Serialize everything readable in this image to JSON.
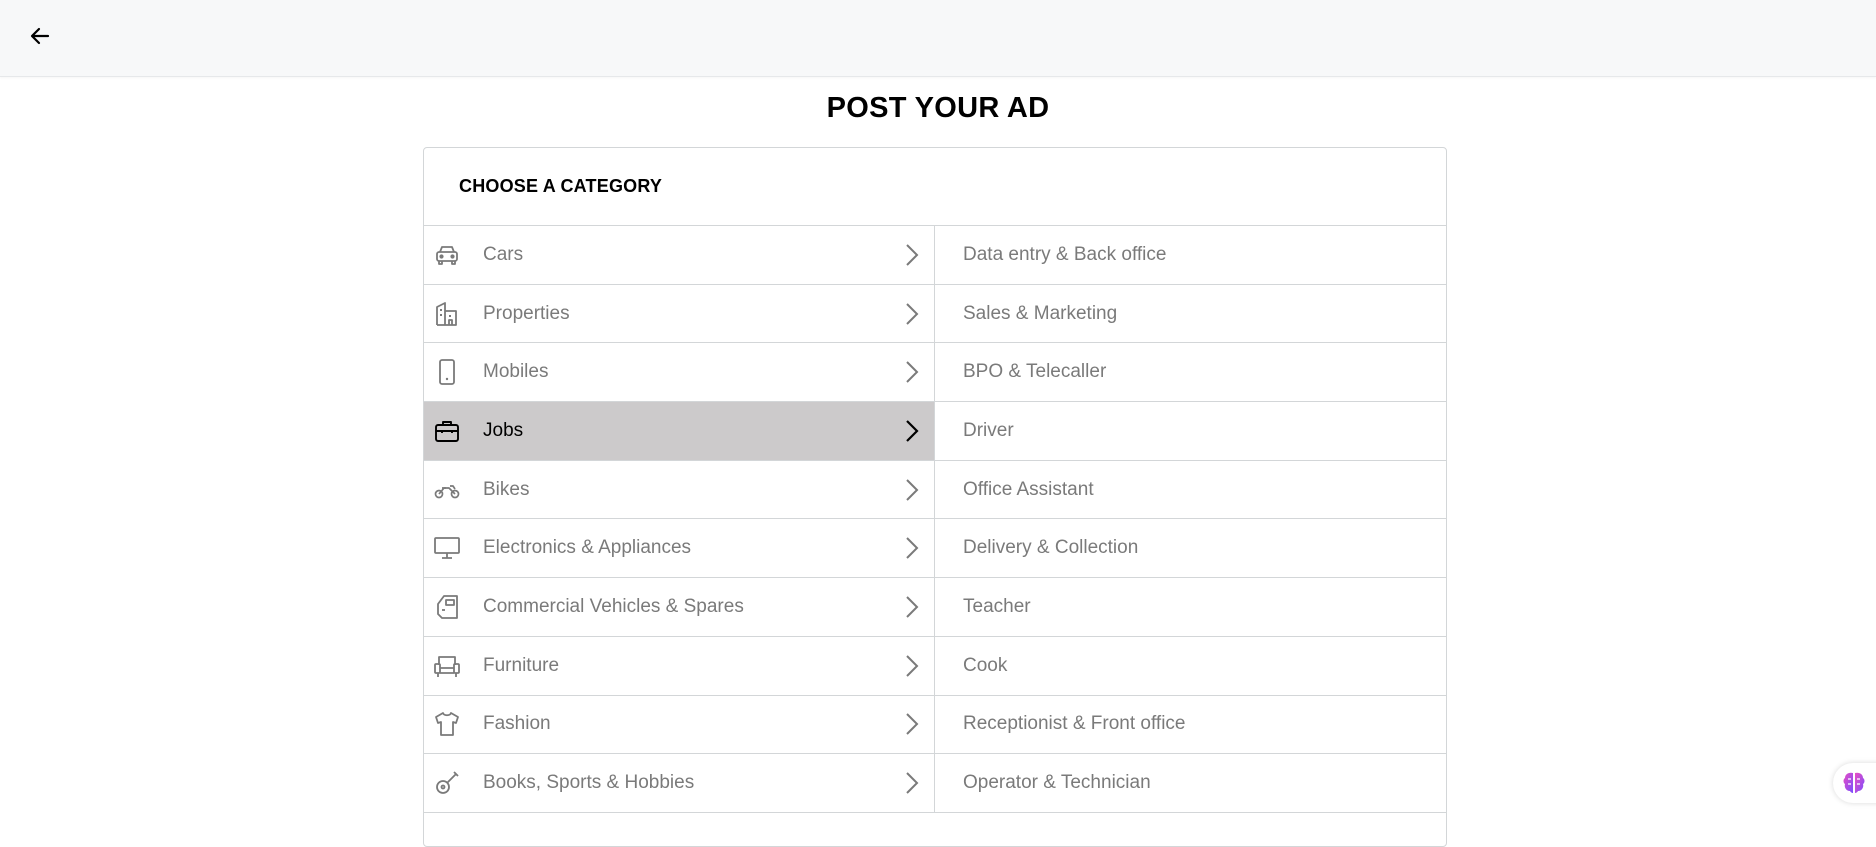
{
  "header": {
    "back_icon": "arrow-left-icon"
  },
  "page": {
    "title": "POST YOUR AD"
  },
  "card": {
    "heading": "CHOOSE A CATEGORY"
  },
  "categories": [
    {
      "label": "Cars",
      "icon": "car-icon"
    },
    {
      "label": "Properties",
      "icon": "building-icon"
    },
    {
      "label": "Mobiles",
      "icon": "mobile-icon"
    },
    {
      "label": "Jobs",
      "icon": "briefcase-icon",
      "selected": true
    },
    {
      "label": "Bikes",
      "icon": "motorbike-icon"
    },
    {
      "label": "Electronics & Appliances",
      "icon": "monitor-icon"
    },
    {
      "label": "Commercial Vehicles & Spares",
      "icon": "truck-icon"
    },
    {
      "label": "Furniture",
      "icon": "sofa-icon"
    },
    {
      "label": "Fashion",
      "icon": "tshirt-icon"
    },
    {
      "label": "Books, Sports & Hobbies",
      "icon": "guitar-icon"
    }
  ],
  "subcategories": [
    "Data entry & Back office",
    "Sales & Marketing",
    "BPO & Telecaller",
    "Driver",
    "Office Assistant",
    "Delivery & Collection",
    "Teacher",
    "Cook",
    "Receptionist & Front office",
    "Operator & Technician"
  ],
  "colors": {
    "selected_bg": "#cccacb",
    "muted_text": "#7a7a7a",
    "border": "#d3d6d8",
    "topbar_bg": "#f7f8f9"
  },
  "fab": {
    "icon": "brain-icon"
  }
}
